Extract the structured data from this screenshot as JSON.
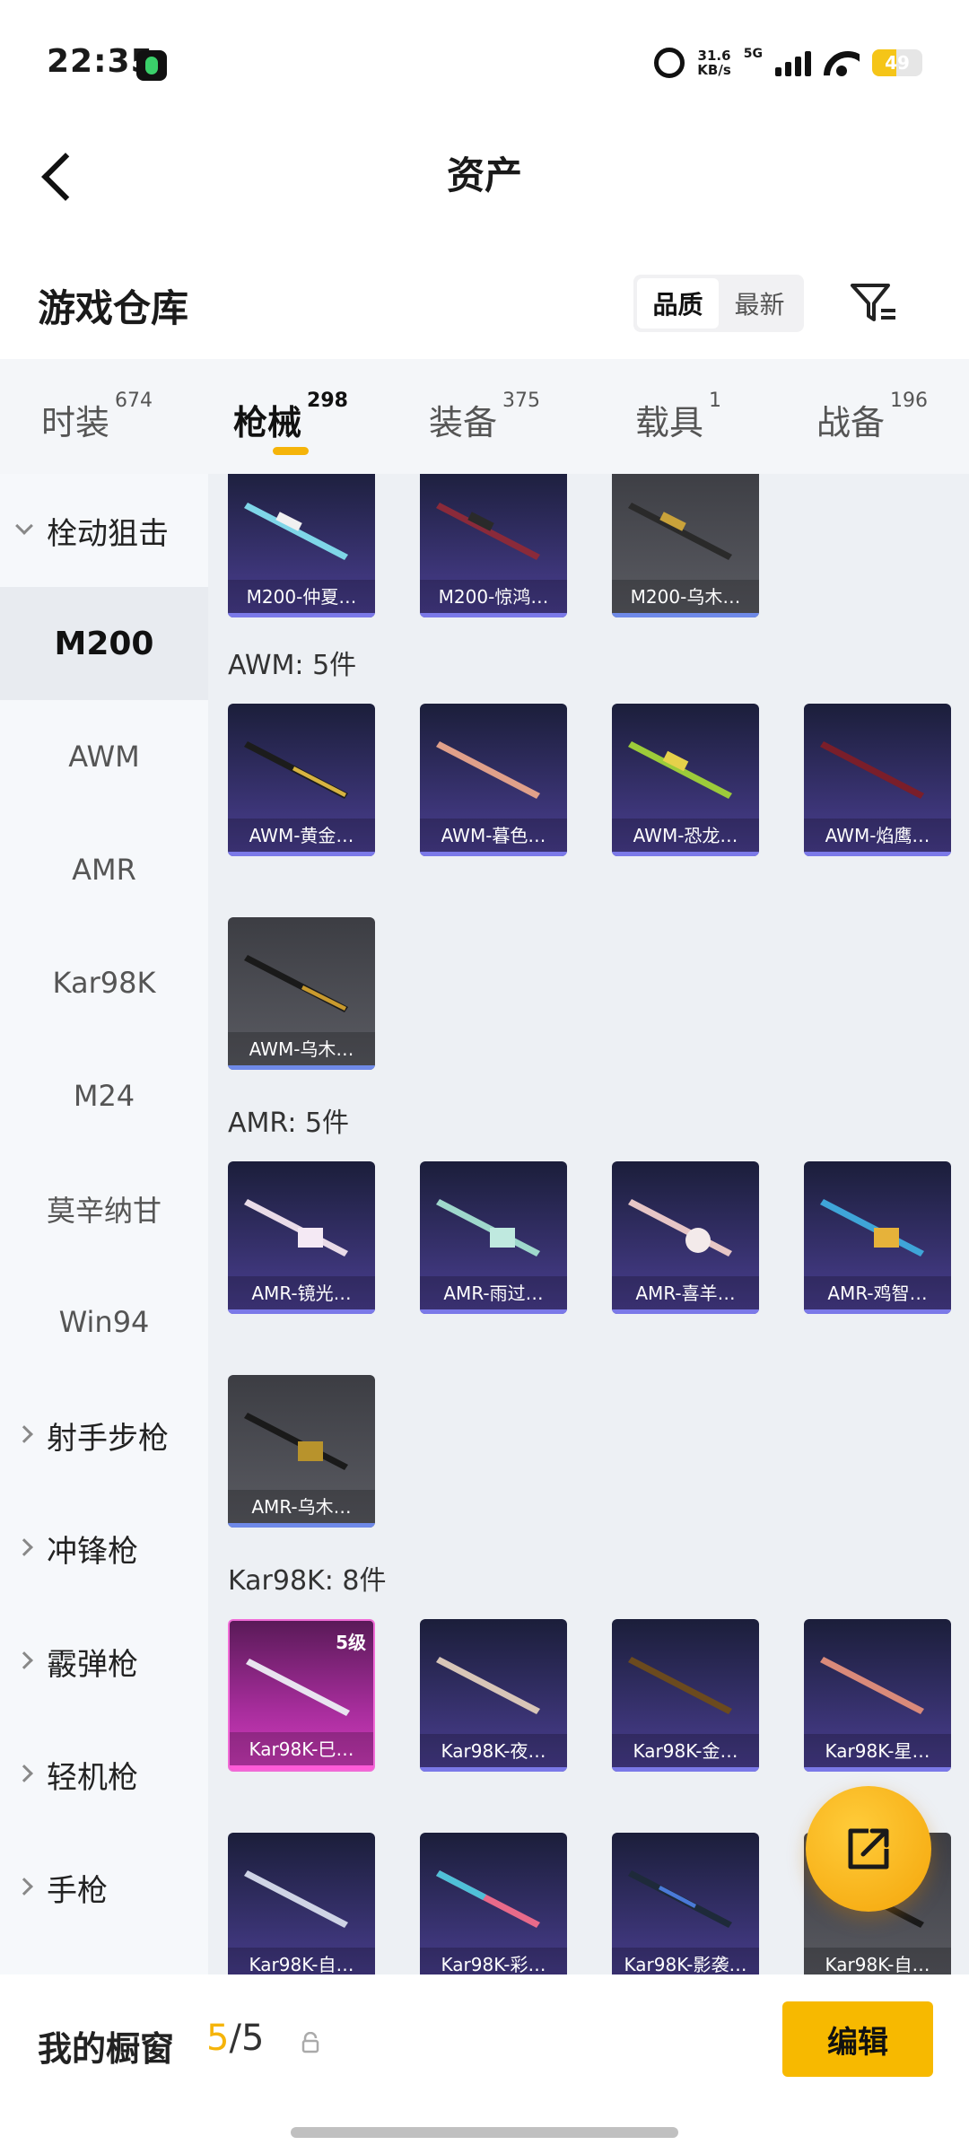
{
  "status_bar": {
    "time": "22:35",
    "net_speed_value": "31.6",
    "net_speed_unit": "KB/s",
    "network": "5G",
    "battery": "49"
  },
  "nav": {
    "title": "资产"
  },
  "section": {
    "title": "游戏仓库",
    "sort_options": [
      "品质",
      "最新"
    ],
    "sort_active": "品质"
  },
  "tabs": [
    {
      "label": "时装",
      "count": "674"
    },
    {
      "label": "枪械",
      "count": "298"
    },
    {
      "label": "装备",
      "count": "375"
    },
    {
      "label": "载具",
      "count": "1"
    },
    {
      "label": "战备",
      "count": "196"
    }
  ],
  "sidebar": {
    "items": [
      "栓动狙击",
      "M200",
      "AWM",
      "AMR",
      "Kar98K",
      "M24",
      "莫辛纳甘",
      "Win94",
      "射手步枪",
      "冲锋枪",
      "霰弹枪",
      "轻机枪",
      "手枪"
    ]
  },
  "groups": {
    "m200_cards": [
      "M200-仲夏…",
      "M200-惊鸿…",
      "M200-乌木…"
    ],
    "awm_label": "AWM: 5件",
    "awm_cards": [
      "AWM-黄金…",
      "AWM-暮色…",
      "AWM-恐龙…",
      "AWM-焰鹰…",
      "AWM-乌木…"
    ],
    "amr_label": "AMR: 5件",
    "amr_cards": [
      "AMR-镜光…",
      "AMR-雨过…",
      "AMR-喜羊…",
      "AMR-鸡智…",
      "AMR-乌木…"
    ],
    "kar_label": "Kar98K: 8件",
    "kar_cards": [
      "Kar98K-巳…",
      "Kar98K-夜…",
      "Kar98K-金…",
      "Kar98K-星…",
      "Kar98K-自…",
      "Kar98K-彩…",
      "Kar98K-影袭…",
      "Kar98K-自…"
    ],
    "kar_level": "5级"
  },
  "bottom": {
    "showcase_label": "我的橱窗",
    "count_current": "5",
    "count_sep": "/",
    "count_total": "5",
    "edit_label": "编辑"
  }
}
